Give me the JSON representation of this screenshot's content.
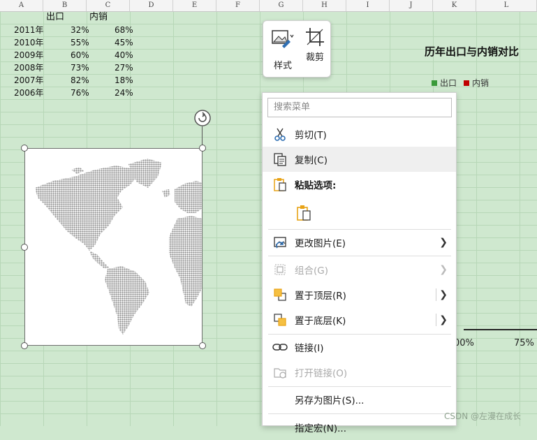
{
  "columns": [
    "A",
    "B",
    "C",
    "D",
    "E",
    "F",
    "G",
    "H",
    "I",
    "J",
    "K",
    "L"
  ],
  "table": {
    "headers": [
      "出口",
      "内销"
    ],
    "rows": [
      {
        "year": "2011年",
        "export": "32%",
        "domestic": "68%"
      },
      {
        "year": "2010年",
        "export": "55%",
        "domestic": "45%"
      },
      {
        "year": "2009年",
        "export": "60%",
        "domestic": "40%"
      },
      {
        "year": "2008年",
        "export": "73%",
        "domestic": "27%"
      },
      {
        "year": "2007年",
        "export": "82%",
        "domestic": "18%"
      },
      {
        "year": "2006年",
        "export": "76%",
        "domestic": "24%"
      }
    ]
  },
  "chart": {
    "title": "历年出口与内销对比",
    "legend": [
      {
        "label": "出口",
        "color": "#3a9a3a"
      },
      {
        "label": "内销",
        "color": "#c00000"
      }
    ],
    "ticks": [
      "00%",
      "75%"
    ]
  },
  "mini_toolbar": {
    "style_label": "样式",
    "crop_label": "裁剪"
  },
  "context_menu": {
    "search_placeholder": "搜索菜单",
    "items": {
      "cut": "剪切(T)",
      "copy": "复制(C)",
      "paste_options": "粘贴选项:",
      "change_picture": "更改图片(E)",
      "group": "组合(G)",
      "bring_front": "置于顶层(R)",
      "send_back": "置于底层(K)",
      "link": "链接(I)",
      "open_link": "打开链接(O)",
      "save_as_picture": "另存为图片(S)...",
      "assign_macro": "指定宏(N)..."
    }
  },
  "watermark": "CSDN @左漫在成长",
  "colors": {
    "sheet_bg": "#cfe8cf",
    "grid_line": "#b7d7b7",
    "icon_orange": "#e8a317",
    "icon_blue": "#2f6fb3"
  }
}
